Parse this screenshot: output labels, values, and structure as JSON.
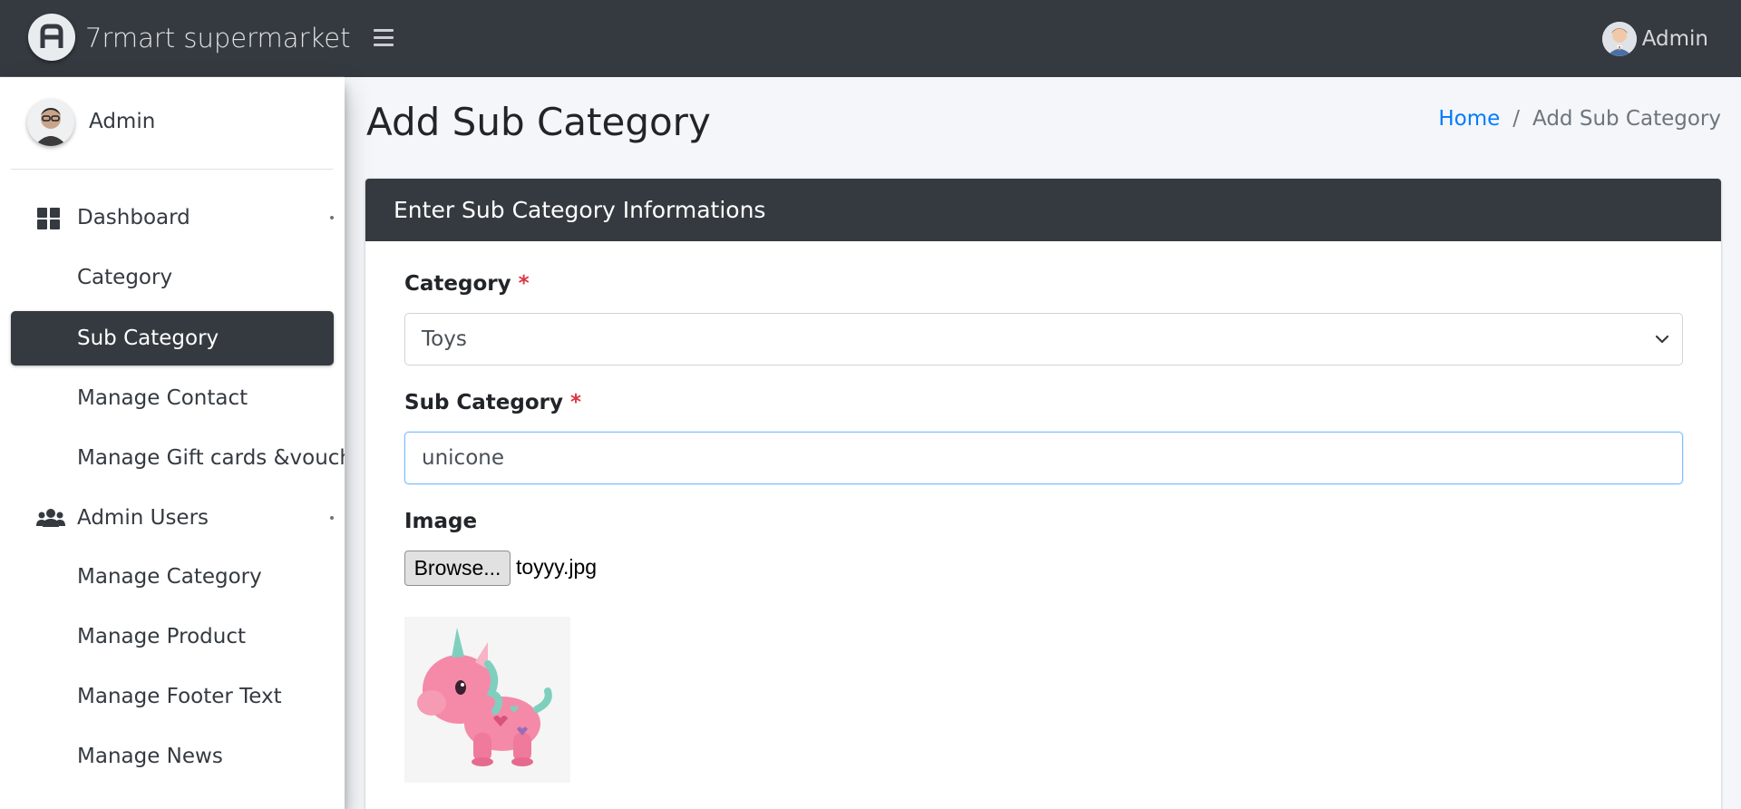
{
  "brand": {
    "name": "7rmart supermarket"
  },
  "topnav": {
    "user_name": "Admin"
  },
  "sidebar": {
    "user_name": "Admin",
    "items": [
      {
        "label": "Dashboard",
        "icon": "dashboard-icon",
        "has_caret": true
      },
      {
        "label": "Category"
      },
      {
        "label": "Sub Category",
        "active": true
      },
      {
        "label": "Manage Contact"
      },
      {
        "label": "Manage Gift cards &voucher"
      },
      {
        "label": "Admin Users",
        "icon": "users-icon",
        "has_caret": true
      },
      {
        "label": "Manage Category"
      },
      {
        "label": "Manage Product"
      },
      {
        "label": "Manage Footer Text"
      },
      {
        "label": "Manage News"
      }
    ]
  },
  "page": {
    "title": "Add Sub Category",
    "breadcrumb": {
      "home": "Home",
      "separator": "/",
      "current": "Add Sub Category"
    }
  },
  "form": {
    "header": "Enter Sub Category Informations",
    "category_label": "Category",
    "category_value": "Toys",
    "subcategory_label": "Sub Category",
    "subcategory_value": "unicone",
    "required_mark": "*",
    "image_label": "Image",
    "browse_label": "Browse...",
    "file_name": "toyyy.jpg"
  },
  "colors": {
    "navbar": "#343a40",
    "active_item": "#343a40",
    "link": "#007bff",
    "required": "#dc3545"
  }
}
